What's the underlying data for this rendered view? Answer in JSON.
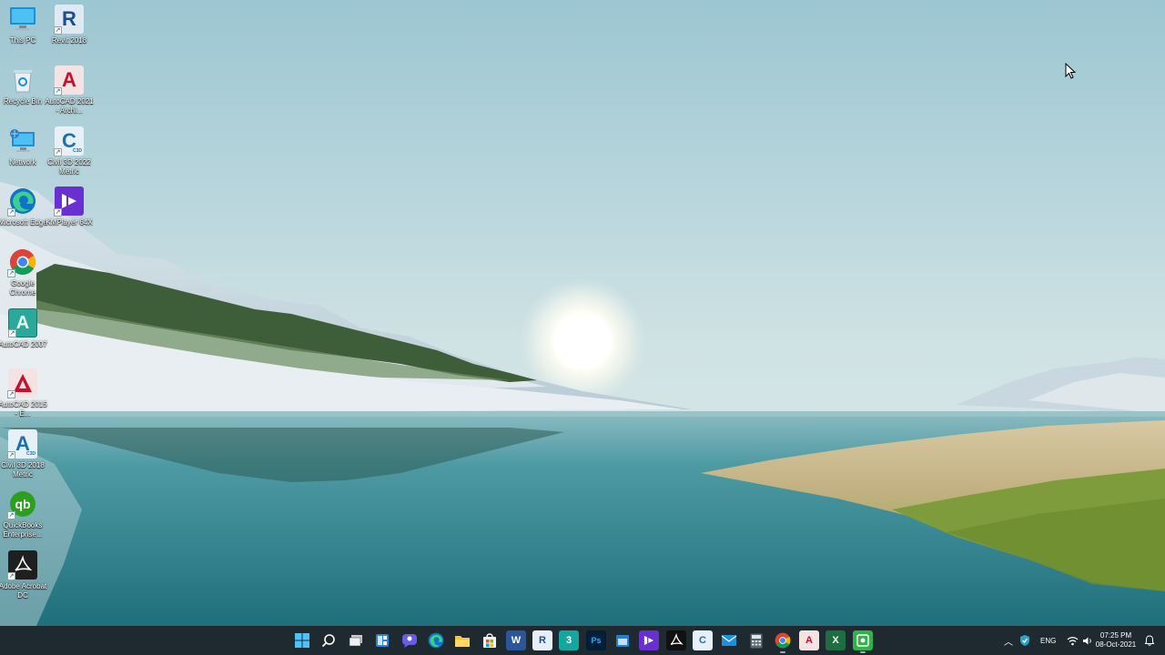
{
  "desktop": {
    "icons": [
      {
        "name": "this-pc",
        "label": "This PC",
        "icon": "computer-monitor-icon"
      },
      {
        "name": "revit-2018",
        "label": "Revit 2018",
        "icon": "revit-icon"
      },
      {
        "name": "recycle-bin",
        "label": "Recycle Bin",
        "icon": "recycle-bin-icon"
      },
      {
        "name": "autocad-2021-arch",
        "label": "AutoCAD 2021 - Archi...",
        "icon": "autocad-icon"
      },
      {
        "name": "network",
        "label": "Network",
        "icon": "network-icon"
      },
      {
        "name": "civil3d-2022",
        "label": "Civil 3D 2022 Metric",
        "icon": "civil3d-icon"
      },
      {
        "name": "microsoft-edge",
        "label": "Microsoft Edge",
        "icon": "edge-icon"
      },
      {
        "name": "kmplayer",
        "label": "KMPlayer 64X",
        "icon": "kmplayer-icon"
      },
      {
        "name": "google-chrome",
        "label": "Google Chrome",
        "icon": "chrome-icon"
      },
      {
        "name": "autocad-2007",
        "label": "AutoCAD 2007",
        "icon": "autocad-2007-icon"
      },
      {
        "name": "autocad-2015",
        "label": "AutoCAD 2015 - E...",
        "icon": "autocad-icon"
      },
      {
        "name": "civil3d-2018",
        "label": "Civil 3D 2018 Metric",
        "icon": "civil3d-icon"
      },
      {
        "name": "quickbooks",
        "label": "QuickBooks Enterprise...",
        "icon": "quickbooks-icon"
      },
      {
        "name": "adobe-acrobat",
        "label": "Adobe Acrobat DC",
        "icon": "acrobat-icon"
      }
    ]
  },
  "taskbar": {
    "apps": [
      {
        "name": "start-button",
        "icon": "windows-logo-icon",
        "text": ""
      },
      {
        "name": "search-button",
        "icon": "search-icon",
        "text": ""
      },
      {
        "name": "task-view-button",
        "icon": "task-view-icon",
        "text": ""
      },
      {
        "name": "widgets-button",
        "icon": "widgets-icon",
        "text": ""
      },
      {
        "name": "chat-button",
        "icon": "chat-icon",
        "text": ""
      },
      {
        "name": "edge-taskbar",
        "icon": "edge-icon",
        "text": ""
      },
      {
        "name": "file-explorer-taskbar",
        "icon": "folder-icon",
        "text": ""
      },
      {
        "name": "store-taskbar",
        "icon": "store-icon",
        "text": ""
      },
      {
        "name": "word-taskbar",
        "icon": "word-icon",
        "text": "W"
      },
      {
        "name": "revit-taskbar",
        "icon": "revit-icon",
        "text": "R"
      },
      {
        "name": "3dsmax-taskbar",
        "icon": "3dsmax-icon",
        "text": "3"
      },
      {
        "name": "photoshop-taskbar",
        "icon": "photoshop-icon",
        "text": "Ps"
      },
      {
        "name": "calendar-taskbar",
        "icon": "calendar-icon",
        "text": ""
      },
      {
        "name": "kmplayer-taskbar",
        "icon": "kmplayer-icon",
        "text": ""
      },
      {
        "name": "acrobat-taskbar",
        "icon": "acrobat-icon",
        "text": ""
      },
      {
        "name": "civil3d-taskbar",
        "icon": "civil3d-icon",
        "text": "C"
      },
      {
        "name": "mail-taskbar",
        "icon": "mail-icon",
        "text": ""
      },
      {
        "name": "calculator-taskbar",
        "icon": "calculator-icon",
        "text": ""
      },
      {
        "name": "chrome-taskbar",
        "icon": "chrome-icon",
        "text": ""
      },
      {
        "name": "autocad-taskbar",
        "icon": "autocad-icon",
        "text": "A"
      },
      {
        "name": "excel-taskbar",
        "icon": "excel-icon",
        "text": "X"
      },
      {
        "name": "camtasia-taskbar",
        "icon": "recorder-icon",
        "text": ""
      }
    ],
    "tray": {
      "language": "ENG",
      "time": "07:25 PM",
      "date": "08-Oct-2021"
    }
  },
  "colors": {
    "taskbar_bg": "#1f2a30",
    "sky_top": "#9cc6d2",
    "water": "#3f8d97"
  }
}
